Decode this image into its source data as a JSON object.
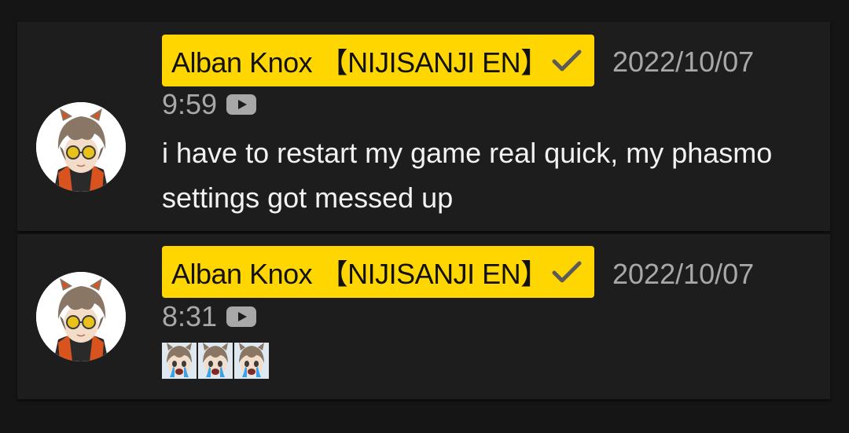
{
  "comments": [
    {
      "author": "Alban Knox 【NIJISANJI EN】",
      "date": "2022/10/07",
      "time": "9:59",
      "message": "i have to restart my game real quick, my phasmo settings got messed up",
      "icons": [
        "avatar",
        "verified-check-icon",
        "youtube-play-icon"
      ]
    },
    {
      "author": "Alban Knox 【NIJISANJI EN】",
      "date": "2022/10/07",
      "time": "8:31",
      "emotes": [
        "crying-emote",
        "crying-emote",
        "crying-emote"
      ],
      "icons": [
        "avatar",
        "verified-check-icon",
        "youtube-play-icon"
      ]
    }
  ],
  "colors": {
    "background": "#151515",
    "card": "#1d1d1d",
    "name_chip": "#ffd600",
    "meta_text": "#a8a8a8",
    "message_text": "#f2f2f2"
  }
}
